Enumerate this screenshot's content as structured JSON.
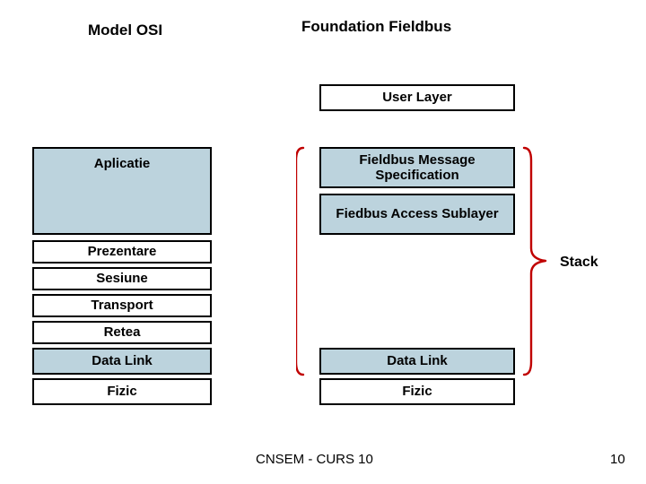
{
  "titles": {
    "osi": "Model OSI",
    "ff": "Foundation Fieldbus"
  },
  "ff": {
    "user": "User Layer",
    "fms": "Fieldbus Message Specification",
    "fas": "Fiedbus Access Sublayer",
    "dl": "Data Link",
    "phys": "Fizic"
  },
  "osi": {
    "app": "Aplicatie",
    "pres": "Prezentare",
    "sess": "Sesiune",
    "trans": "Transport",
    "net": "Retea",
    "dl": "Data Link",
    "phys": "Fizic"
  },
  "stack_label": "Stack",
  "footer": "CNSEM - CURS 10",
  "page": "10"
}
